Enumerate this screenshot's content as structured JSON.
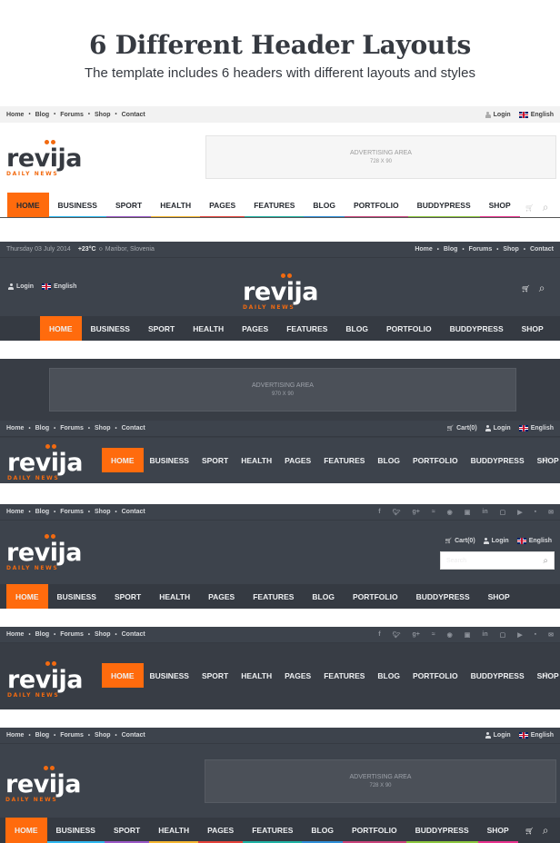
{
  "heading": {
    "title": "6 Different Header Layouts",
    "subtitle": "The template includes 6 headers with different layouts and styles"
  },
  "brand": {
    "logo": "revija",
    "tagline": "DAILY NEWS",
    "accent": "#ff6b0d"
  },
  "top_links": [
    "Home",
    "Blog",
    "Forums",
    "Shop",
    "Contact"
  ],
  "nav_items": [
    "HOME",
    "BUSINESS",
    "SPORT",
    "HEALTH",
    "PAGES",
    "FEATURES",
    "BLOG",
    "PORTFOLIO",
    "BUDDYPRESS",
    "SHOP"
  ],
  "nav_colors": [
    "#ff6b0d",
    "#2fb8f0",
    "#9b59c7",
    "#f5b731",
    "#e4433b",
    "#20b2a4",
    "#2f8fd8",
    "#c9457c",
    "#8cc63f",
    "#e8348f"
  ],
  "account": {
    "login": "Login",
    "language": "English",
    "cart": "Cart(0)"
  },
  "ads": {
    "label": "ADVERTISING AREA",
    "size_728": "728 X 90",
    "size_970": "970 X 90"
  },
  "header2": {
    "date": "Thursday 03 July 2014",
    "temperature": "+23°C",
    "location": "Maribor, Slovenia"
  },
  "search": {
    "placeholder": "Search"
  },
  "social_icons": [
    "facebook-icon",
    "twitter-icon",
    "google-plus-icon",
    "rss-icon",
    "pinterest-icon",
    "instagram-icon",
    "linkedin-icon",
    "vimeo-icon",
    "youtube-icon",
    "flickr-icon",
    "email-icon"
  ],
  "icons": {
    "cart": "🛒",
    "search": "⌕"
  }
}
